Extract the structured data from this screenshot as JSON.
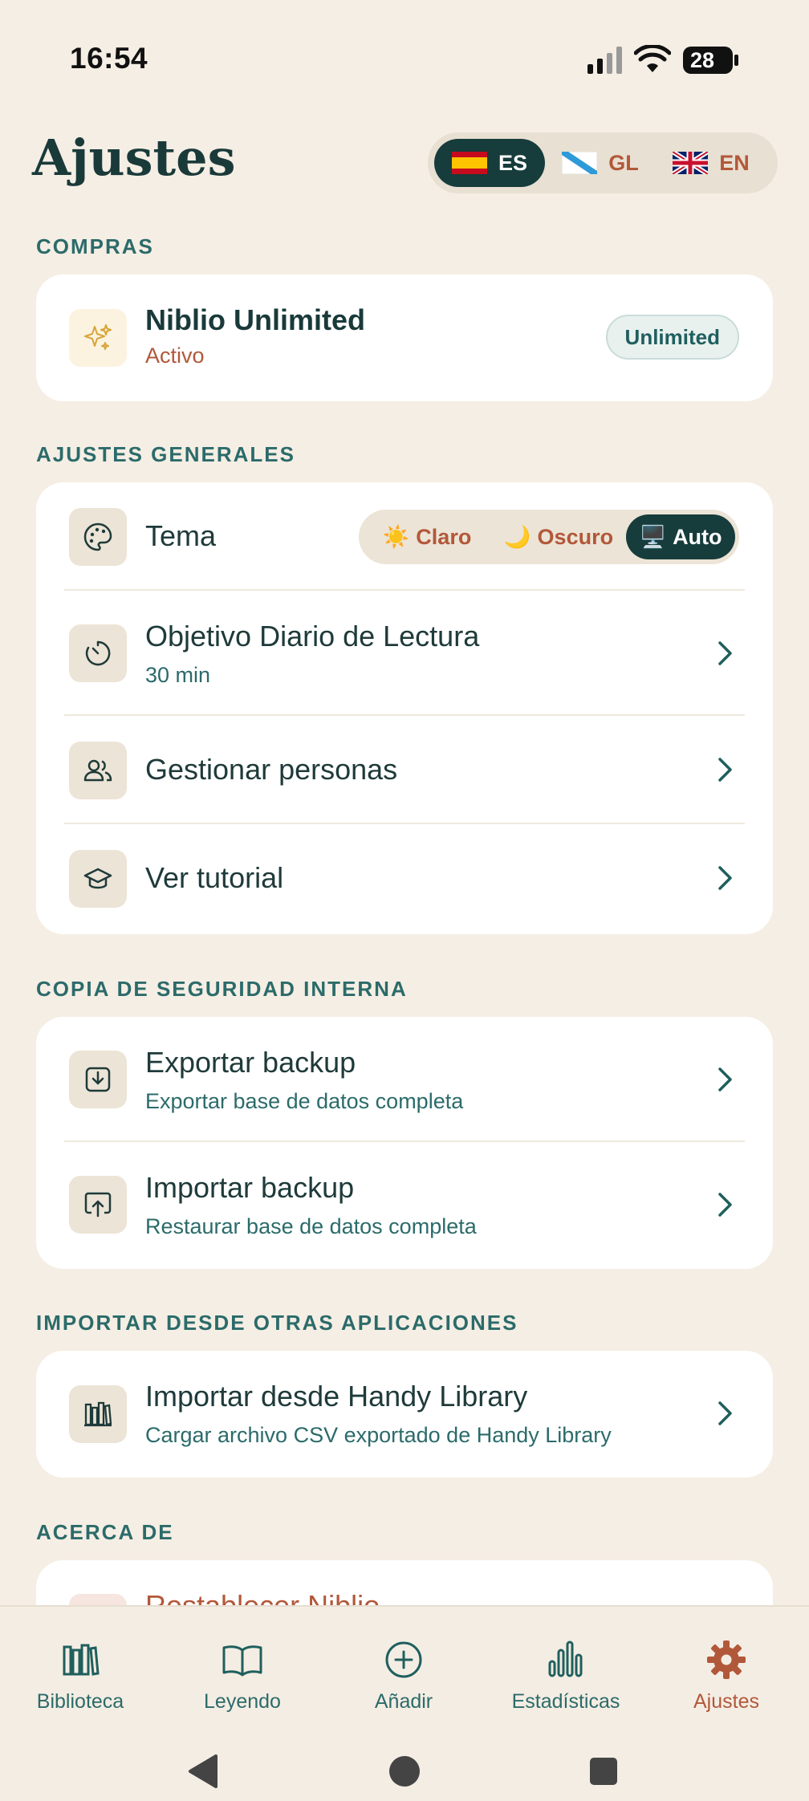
{
  "status_bar": {
    "time": "16:54",
    "battery": "28"
  },
  "header": {
    "title": "Ajustes",
    "languages": [
      {
        "code": "ES",
        "active": true
      },
      {
        "code": "GL",
        "active": false
      },
      {
        "code": "EN",
        "active": false
      }
    ]
  },
  "purchases": {
    "label": "COMPRAS",
    "title": "Niblio Unlimited",
    "status": "Activo",
    "badge": "Unlimited",
    "icon": "sparkles-icon"
  },
  "general": {
    "label": "AJUSTES GENERALES",
    "theme": {
      "label": "Tema",
      "icon": "palette-icon",
      "options": [
        {
          "emoji": "☀️",
          "label": "Claro",
          "active": false
        },
        {
          "emoji": "🌙",
          "label": "Oscuro",
          "active": false
        },
        {
          "emoji": "🖥️",
          "label": "Auto",
          "active": true
        }
      ]
    },
    "daily_goal": {
      "title": "Objetivo Diario de Lectura",
      "value": "30 min",
      "icon": "timer-icon"
    },
    "people": {
      "title": "Gestionar personas",
      "icon": "users-icon"
    },
    "tutorial": {
      "title": "Ver tutorial",
      "icon": "graduation-cap-icon"
    }
  },
  "backup": {
    "label": "COPIA DE SEGURIDAD INTERNA",
    "export": {
      "title": "Exportar backup",
      "subtitle": "Exportar base de datos completa",
      "icon": "download-icon"
    },
    "import": {
      "title": "Importar backup",
      "subtitle": "Restaurar base de datos completa",
      "icon": "upload-icon"
    }
  },
  "import_apps": {
    "label": "IMPORTAR DESDE OTRAS APLICACIONES",
    "handy": {
      "title": "Importar desde Handy Library",
      "subtitle": "Cargar archivo CSV exportado de Handy Library",
      "icon": "library-icon"
    }
  },
  "about": {
    "label": "ACERCA DE",
    "reset": {
      "title": "Restablecer Niblio"
    }
  },
  "nav": {
    "items": [
      {
        "label": "Biblioteca",
        "icon": "library-icon",
        "active": false
      },
      {
        "label": "Leyendo",
        "icon": "book-open-icon",
        "active": false
      },
      {
        "label": "Añadir",
        "icon": "plus-circle-icon",
        "active": false
      },
      {
        "label": "Estadísticas",
        "icon": "bar-chart-icon",
        "active": false
      },
      {
        "label": "Ajustes",
        "icon": "gear-icon",
        "active": true
      }
    ]
  },
  "colors": {
    "background": "#f5eee4",
    "primary_dark": "#173c3c",
    "accent": "#b2583a",
    "teal": "#2b6b6a"
  }
}
